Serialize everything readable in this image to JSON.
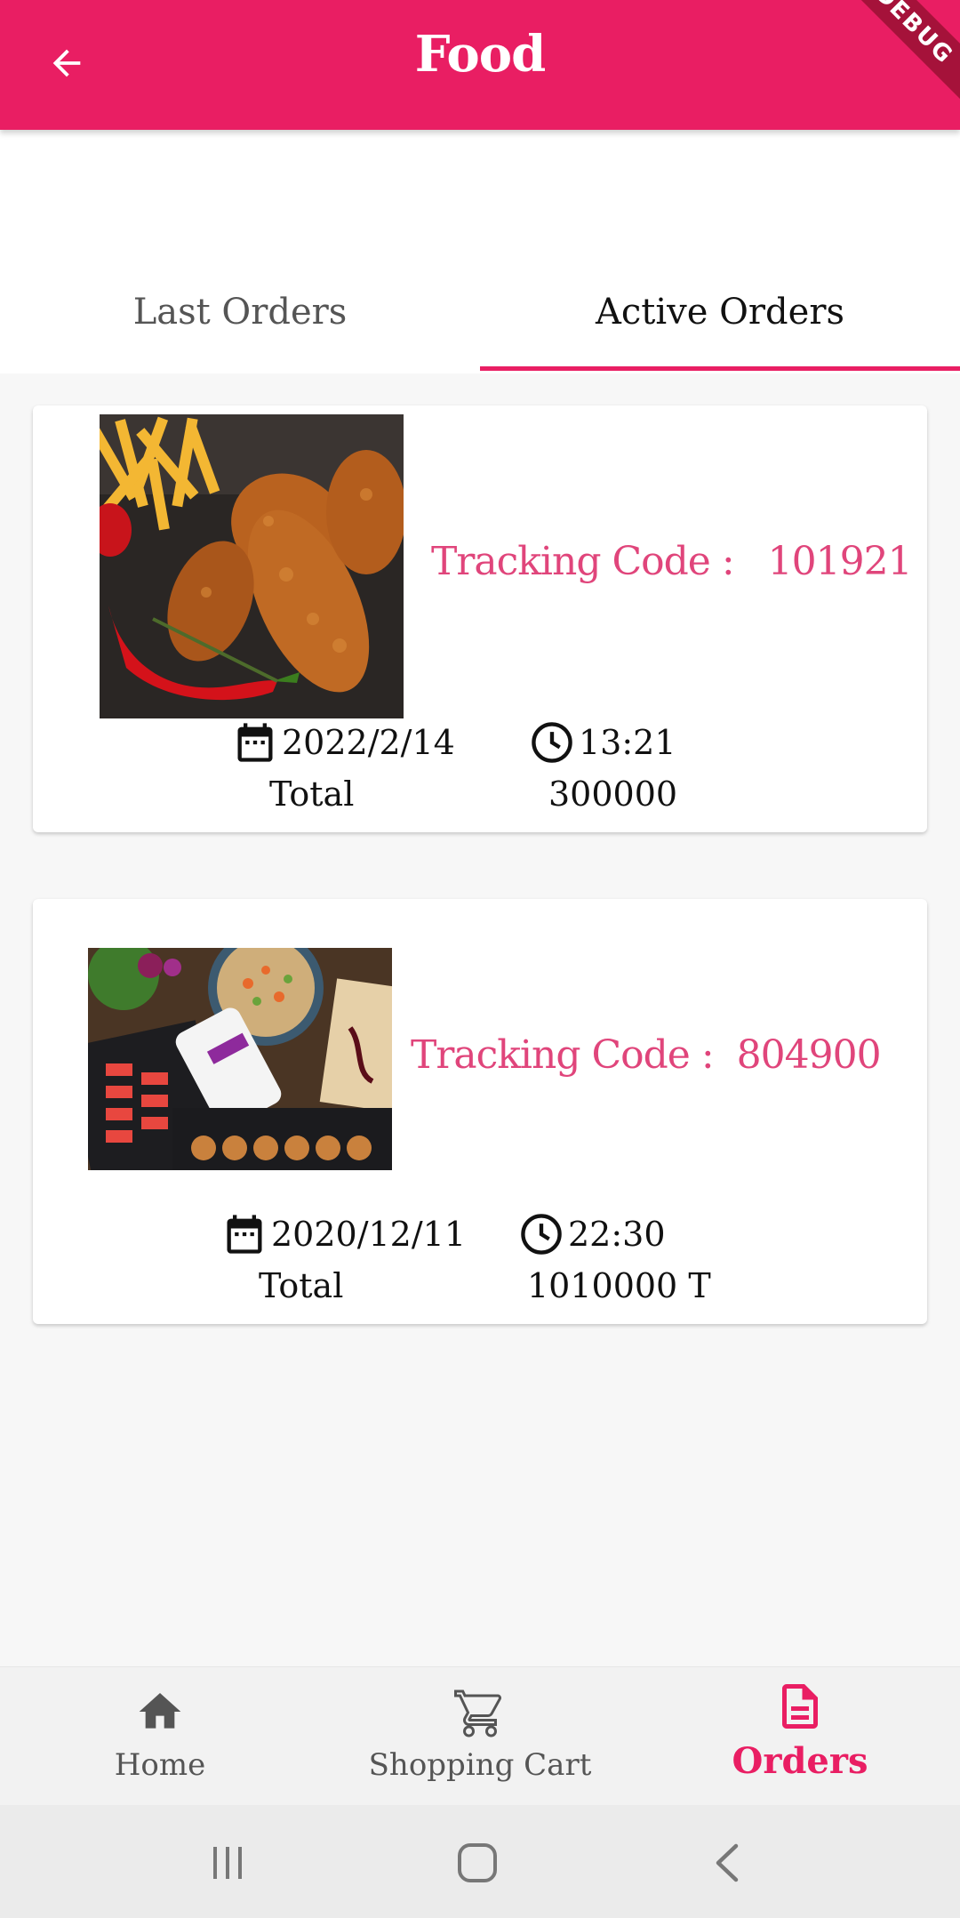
{
  "appbar": {
    "title": "Food",
    "debug_label": "DEBUG",
    "color": "#e91e63"
  },
  "tabs": [
    {
      "label": "Last Orders",
      "active": false
    },
    {
      "label": "Active Orders",
      "active": true
    }
  ],
  "orders": [
    {
      "image": "fried-chicken-photo",
      "tracking_label": "Tracking Code :",
      "tracking_code": "101921",
      "date": "2022/2/14",
      "time": "13:21",
      "total_label": "Total",
      "total_value": "300000"
    },
    {
      "image": "assorted-food-platter-photo",
      "tracking_label": "Tracking Code :",
      "tracking_code": "804900",
      "date": "2020/12/11",
      "time": "22:30",
      "total_label": "Total",
      "total_value": "1010000 T"
    }
  ],
  "bottom_nav": [
    {
      "label": "Home",
      "icon": "home-icon",
      "active": false
    },
    {
      "label": "Shopping Cart",
      "icon": "cart-icon",
      "active": false
    },
    {
      "label": "Orders",
      "icon": "document-icon",
      "active": true
    }
  ],
  "accent_color": "#e0457b"
}
